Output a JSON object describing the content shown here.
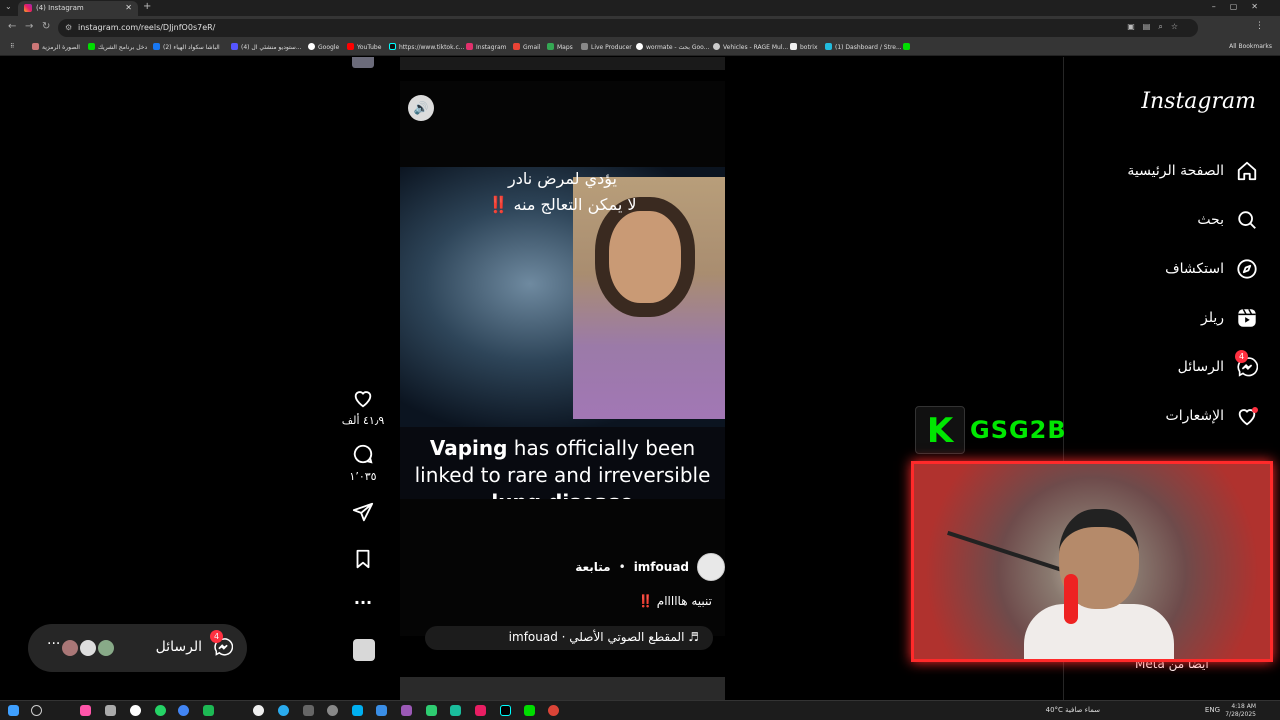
{
  "browser": {
    "tab_title": "(4) Instagram",
    "url": "instagram.com/reels/DJjnfO0s7eR/",
    "bookmarks": [
      "الصورة الرمزية",
      "دخل برنامج الشريك",
      "(2) الباشا سكواد الهياء",
      "(4) ستوديو منشئي ال...",
      "Google",
      "YouTube",
      "https://www.tiktok.c...",
      "Instagram",
      "Gmail",
      "Maps",
      "Live Producer",
      "wormate - بحث Goo...",
      "Vehicles - RAGE Mul...",
      "botrix",
      "(1) Dashboard / Stre..."
    ],
    "all_bookmarks": "All Bookmarks"
  },
  "sidebar": {
    "logo": "Instagram",
    "items": [
      {
        "label": "الصفحة الرئيسية",
        "icon": "home-icon"
      },
      {
        "label": "بحث",
        "icon": "search-icon"
      },
      {
        "label": "استكشاف",
        "icon": "explore-icon"
      },
      {
        "label": "ريلز",
        "icon": "reels-icon"
      },
      {
        "label": "الرسائل",
        "icon": "messenger-icon",
        "badge": "4"
      },
      {
        "label": "الإشعارات",
        "icon": "heart-icon"
      }
    ],
    "also_from_meta": "أيضًا من Meta"
  },
  "reel": {
    "overlay_line1": "يؤدي لمرض نادر",
    "overlay_line2": "لا يمكن التعالج منه ‼️",
    "caption_bold1": "Vaping",
    "caption_rest1": " has officially been",
    "caption_line2": "linked to rare and irreversible",
    "caption_bold3": "lung disease",
    "author": "imfouad",
    "separator": "•",
    "follow": "متابعة",
    "post_caption": "تنبيه هااااام ‼️",
    "audio": "♬ المقطع الصوتي الأصلي · imfouad"
  },
  "actions": {
    "likes": "٤١٫٩ ألف",
    "comments": "١٬٠٣٥"
  },
  "messages_pill": {
    "label": "الرسائل",
    "badge": "4",
    "more": "···"
  },
  "stream": {
    "k_letter": "K",
    "channel_name": "GSG2B"
  },
  "taskbar": {
    "weather": "40°C سماء صافية",
    "lang": "ENG",
    "time": "4:18 AM",
    "date": "7/28/2025"
  },
  "colors": {
    "accent_red": "#ff3040",
    "kick_green": "#00e701"
  }
}
